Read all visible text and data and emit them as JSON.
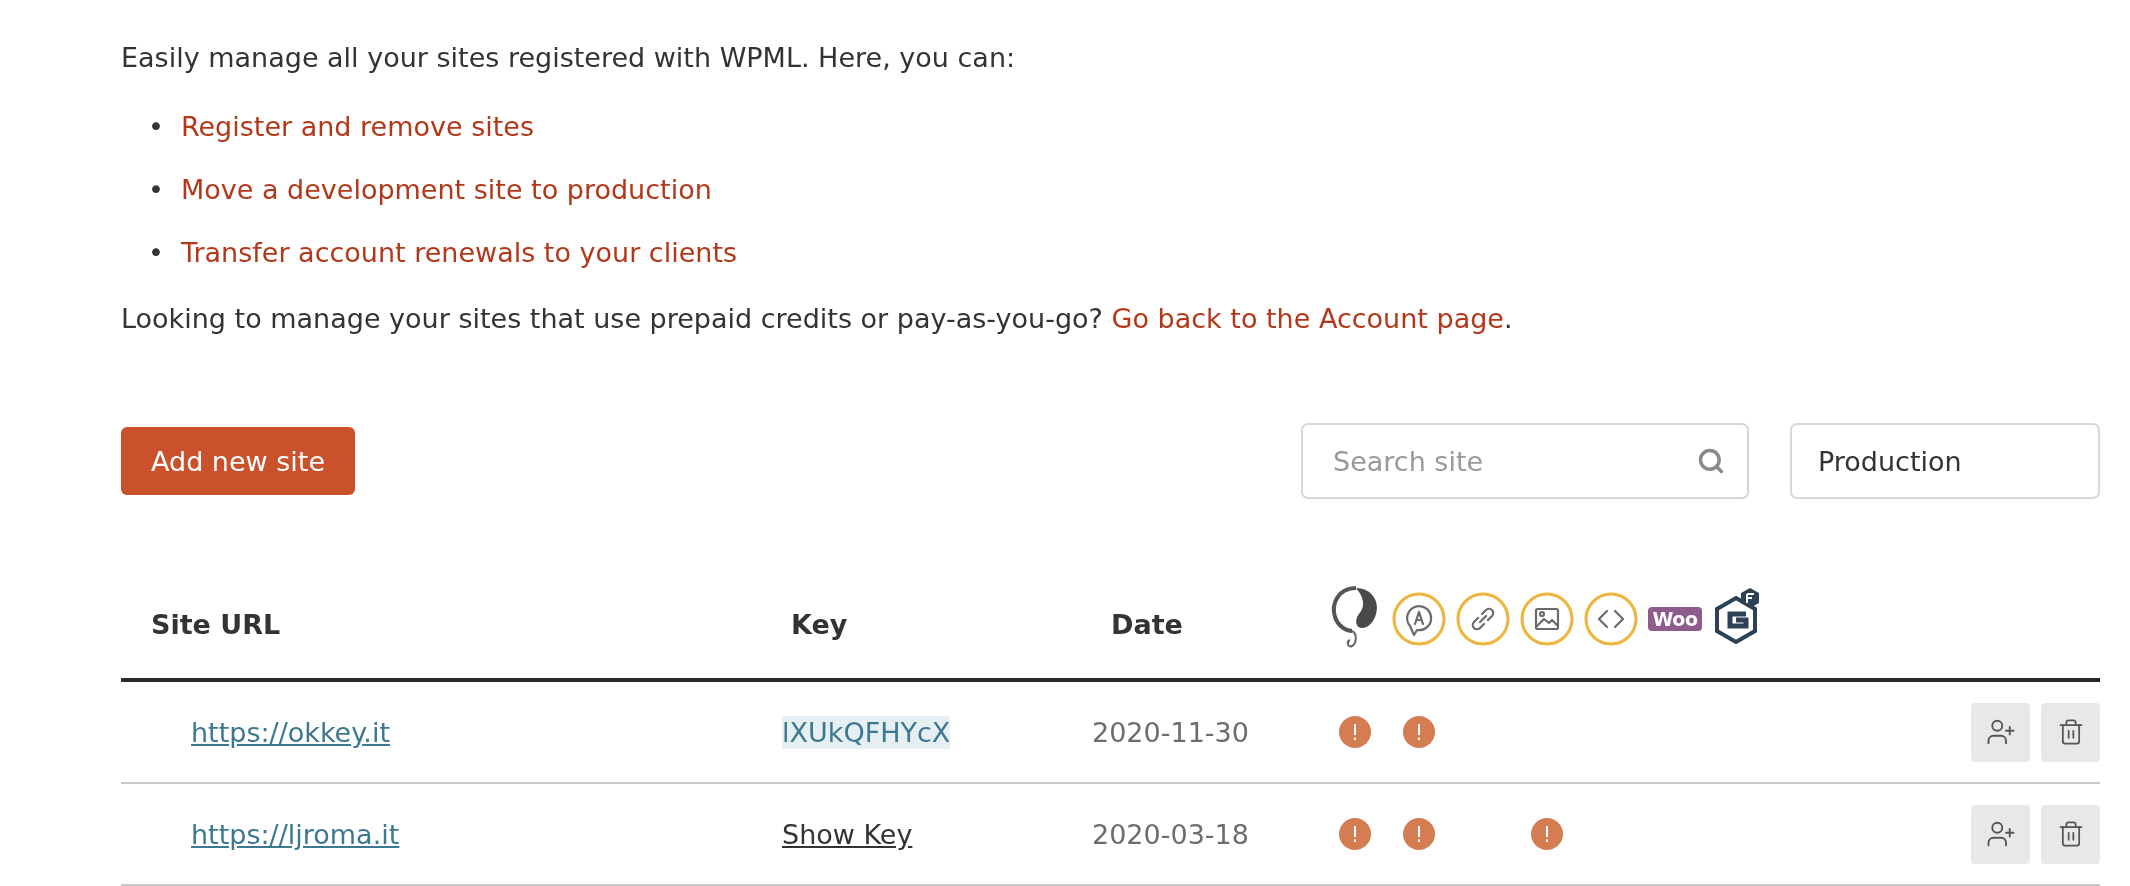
{
  "intro": "Easily manage all your sites registered with WPML. Here, you can:",
  "features": [
    {
      "marker": "•",
      "text": "Register and remove sites"
    },
    {
      "marker": "•",
      "text": "Move a development site to production"
    },
    {
      "marker": "•",
      "text": "Transfer account renewals to your clients"
    }
  ],
  "note": {
    "text": "Looking to manage your sites that use prepaid credits or pay-as-you-go? ",
    "link": "Go back to the Account page",
    "after": "."
  },
  "toolbar": {
    "add_button": "Add new site",
    "search": {
      "placeholder": "Search site"
    },
    "filter": {
      "value": "Production"
    }
  },
  "table": {
    "columns": [
      {
        "label": "Site URL"
      },
      {
        "label": "Key"
      },
      {
        "label": "Date"
      }
    ],
    "plugin_columns": [
      {
        "kind": "support"
      },
      {
        "kind": "translate"
      },
      {
        "kind": "link"
      },
      {
        "kind": "image"
      },
      {
        "kind": "code"
      },
      {
        "kind": "woo",
        "label": "Woo"
      },
      {
        "kind": "gravity"
      }
    ],
    "rows": [
      {
        "url": "https://okkey.it",
        "key": {
          "kind": "value",
          "text": "lXUkQFHYcX"
        },
        "date": "2020-11-30",
        "alerts": [
          true,
          true,
          false,
          false,
          false,
          false,
          false
        ]
      },
      {
        "url": "https://ljroma.it",
        "key": {
          "kind": "toggle",
          "text": "Show Key"
        },
        "date": "2020-03-18",
        "alerts": [
          true,
          true,
          false,
          true,
          false,
          false,
          false
        ]
      }
    ]
  }
}
